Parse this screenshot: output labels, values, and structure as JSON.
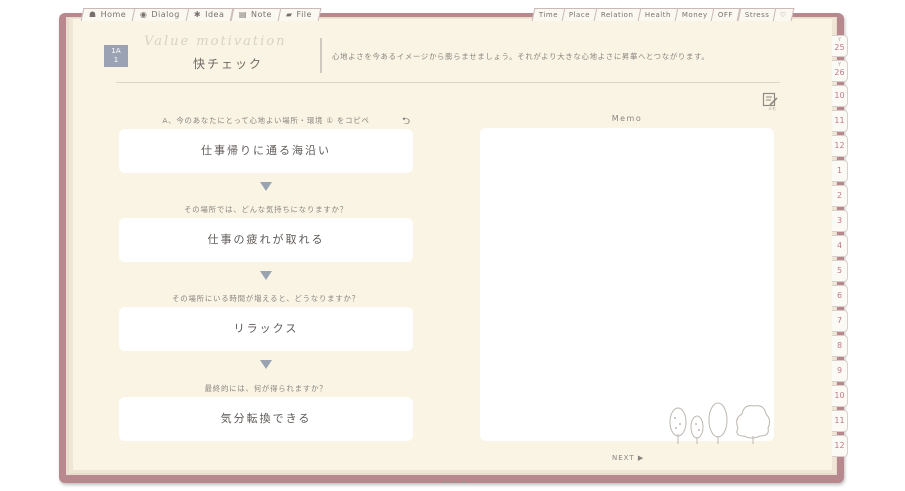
{
  "nav_tabs_left": [
    {
      "label": "Home",
      "icon": "home-icon"
    },
    {
      "label": "Dialog",
      "icon": "dialog-icon"
    },
    {
      "label": "Idea",
      "icon": "lightbulb-icon"
    },
    {
      "label": "Note",
      "icon": "note-icon"
    },
    {
      "label": "File",
      "icon": "folder-icon"
    }
  ],
  "nav_tabs_right": [
    {
      "label": "Time"
    },
    {
      "label": "Place"
    },
    {
      "label": "Relation"
    },
    {
      "label": "Health"
    },
    {
      "label": "Money"
    },
    {
      "label": "OFF"
    },
    {
      "label": "Stress"
    },
    {
      "label": "",
      "icon": "heart-icon"
    }
  ],
  "month_tabs": [
    {
      "label": "25",
      "year": "Y"
    },
    {
      "label": "26",
      "year": "Y"
    },
    {
      "label": "10"
    },
    {
      "label": "11"
    },
    {
      "label": "12"
    },
    {
      "label": "1"
    },
    {
      "label": "2"
    },
    {
      "label": "3"
    },
    {
      "label": "4"
    },
    {
      "label": "5"
    },
    {
      "label": "6"
    },
    {
      "label": "7"
    },
    {
      "label": "8"
    },
    {
      "label": "9"
    },
    {
      "label": "10"
    },
    {
      "label": "11"
    },
    {
      "label": "12"
    }
  ],
  "header": {
    "badge_top": "1A",
    "badge_bottom": "1",
    "script_title": "Value motivation",
    "title": "快チェック",
    "description": "心地よさを今あるイメージから膨らませましょう。それがより大きな心地よさに昇華へとつながります。"
  },
  "questions": [
    {
      "question": "A、今のあなたにとって心地よい場所・環境 ① をコピペ",
      "answer": "仕事帰りに通る海沿い"
    },
    {
      "question": "その場所では、どんな気持ちになりますか？",
      "answer": "仕事の疲れが取れる"
    },
    {
      "question": "その場所にいる時間が増えると、どうなりますか？",
      "answer": "リラックス"
    },
    {
      "question": "最終的には、何が得られますか？",
      "answer": "気分転換できる"
    }
  ],
  "memo": {
    "label": "Memo",
    "value": ""
  },
  "footer": {
    "next_label": "NEXT ▶",
    "dots": "• • •"
  },
  "edit_icon_caption": "メモ",
  "colors": {
    "cover": "#b8888f",
    "page": "#faf4e4",
    "accent": "#9aa3b0",
    "month_text": "#c07b86"
  }
}
